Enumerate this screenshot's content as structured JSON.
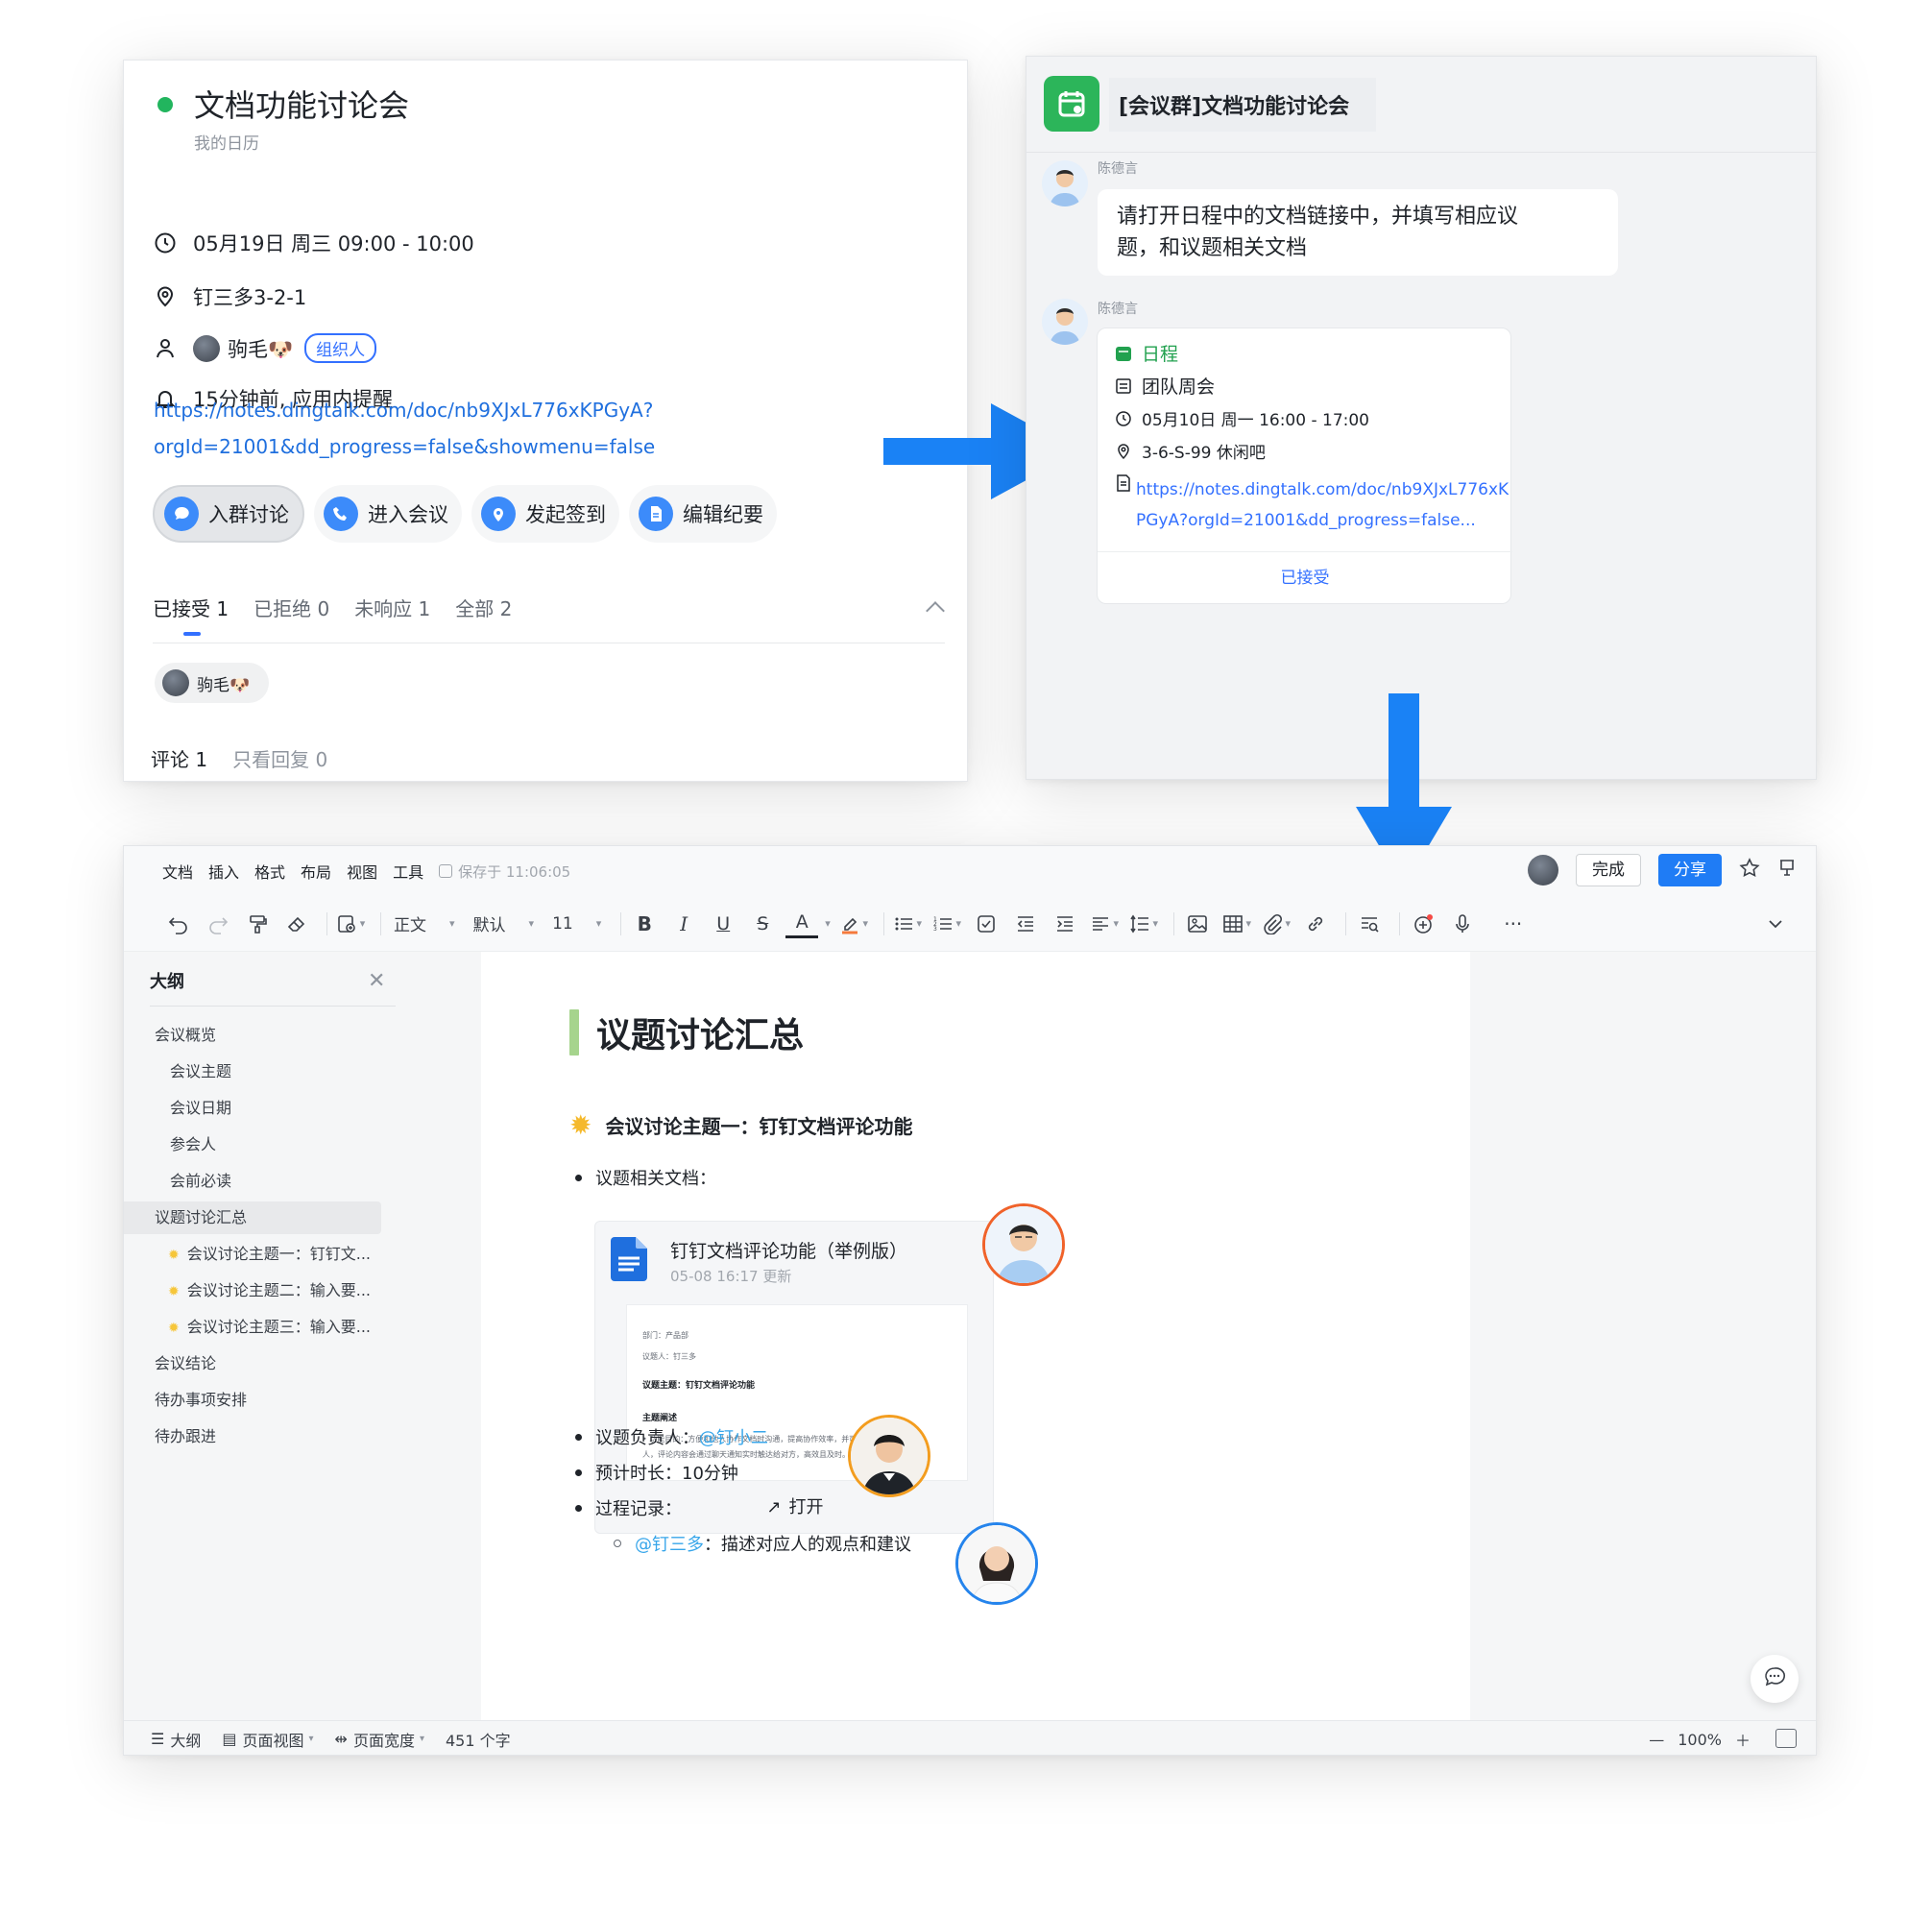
{
  "event": {
    "title": "文档功能讨论会",
    "calendar": "我的日历",
    "datetime": "05月19日 周三 09:00 - 10:00",
    "location": "钉三多3-2-1",
    "organizer_name": "驹毛🐶",
    "organizer_badge": "组织人",
    "reminder": "15分钟前, 应用内提醒",
    "link_line1": "https://notes.dingtalk.com/doc/nb9XJxL776xKPGyA?",
    "link_line2": "orgId=21001&dd_progress=false&showmenu=false",
    "status_color": "#22b55e",
    "actions": [
      {
        "label": "入群讨论",
        "icon": "chat-bubble-icon"
      },
      {
        "label": "进入会议",
        "icon": "phone-icon"
      },
      {
        "label": "发起签到",
        "icon": "location-pin-icon"
      },
      {
        "label": "编辑纪要",
        "icon": "document-icon"
      }
    ],
    "tabs": [
      "已接受 1",
      "已拒绝 0",
      "未响应 1",
      "全部 2"
    ],
    "attendee": "驹毛🐶",
    "comments_label": "评论 1",
    "replies_label": "只看回复 0"
  },
  "chat": {
    "group_title": "[会议群]文档功能讨论会",
    "sender1": "陈德言",
    "message_line1": "请打开日程中的文档链接中，并填写相应议",
    "message_line2": "题，和议题相关文档",
    "sender2": "陈德言",
    "card": {
      "type_label": "日程",
      "title": "团队周会",
      "time": "05月10日 周一 16:00 - 17:00",
      "place": "3-6-S-99 休闲吧",
      "url_line1": "https://notes.dingtalk.com/doc/nb9XJxL776xK",
      "url_line2": "PGyA?orgId=21001&dd_progress=false...",
      "status": "已接受"
    },
    "accent": "#2cb55a"
  },
  "doc": {
    "menu": [
      "文档",
      "插入",
      "格式",
      "布局",
      "视图",
      "工具"
    ],
    "save_status": "保存于 11:06:05",
    "done_label": "完成",
    "share_label": "分享",
    "toolbar": {
      "style": "正文",
      "font": "默认",
      "size": "11"
    },
    "outline": {
      "title": "大纲",
      "items": [
        {
          "label": "会议概览",
          "level": 1
        },
        {
          "label": "会议主题",
          "level": 2
        },
        {
          "label": "会议日期",
          "level": 2
        },
        {
          "label": "参会人",
          "level": 2
        },
        {
          "label": "会前必读",
          "level": 2
        },
        {
          "label": "议题讨论汇总",
          "level": 1
        },
        {
          "label": "会议讨论主题一：钉钉文...",
          "level": 3
        },
        {
          "label": "会议讨论主题二：输入要...",
          "level": 3
        },
        {
          "label": "会议讨论主题三：输入要...",
          "level": 3
        },
        {
          "label": "会议结论",
          "level": 1
        },
        {
          "label": "待办事项安排",
          "level": 1
        },
        {
          "label": "待办跟进",
          "level": 1
        }
      ]
    },
    "heading": "议题讨论汇总",
    "subheading": "会议讨论主题一：钉钉文档评论功能",
    "bullet_docs": "议题相关文档：",
    "file_card": {
      "title": "钉钉文档评论功能（举例版）",
      "meta": "05-08 16:17 更新",
      "preview_dept": "部门：产品部",
      "preview_person": "议题人：钉三多",
      "preview_topic": "议题主题：钉钉文档评论功能",
      "preview_section": "主题阐述",
      "preview_body1": "• 功能目的：方便和他人协作文档时沟通，提高协作效率，并可在评论中 @ 相关的",
      "preview_body2": "人，评论内容会通过聊天通知实时触达给对方，高效且及时。",
      "open_label": "打开"
    },
    "owner_label": "议题负责人：",
    "owner_mention": "@钉小二",
    "duration": "预计时长：10分钟",
    "process_label": "过程记录：",
    "sub_mention": "@钉三多",
    "sub_text": "：描述对应人的观点和建议",
    "status": {
      "outline_label": "大纲",
      "page_view": "页面视图",
      "page_width": "页面宽度",
      "word_count": "451 个字",
      "zoom": "100%"
    }
  }
}
